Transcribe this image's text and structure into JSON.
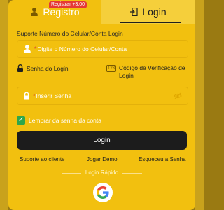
{
  "tabs": {
    "register": {
      "label": "Registro",
      "badge": "Registrar +3,00"
    },
    "login": {
      "label": "Login"
    }
  },
  "form": {
    "phone_label": "Suporte Número do Celular/Conta Login",
    "phone_placeholder": "Digite o Número do Celular/Conta",
    "mode_password": "Senha do Login",
    "mode_code": "Código de Verificação de Login",
    "password_placeholder": "Inserir Senha",
    "remember_label": "Lembrar da senha da conta",
    "submit_label": "Login"
  },
  "links": {
    "support": "Suporte ao cliente",
    "demo": "Jogar Demo",
    "forgot": "Esqueceu a Senha"
  },
  "quick_login": {
    "label": "Login Rápido"
  },
  "colors": {
    "panel": "#f2c00f",
    "button": "#1c1c1c",
    "checkbox": "#2fa64b",
    "badge": "#e53935"
  },
  "icons": {
    "register": "user-icon",
    "login": "login-door-icon",
    "phone_field": "user-icon",
    "password_mode": "lock-icon",
    "code_mode": "code-123-icon",
    "password_field": "lock-icon",
    "visibility": "eye-off-icon",
    "remember": "checkmark-icon",
    "quick_login": "google-icon"
  }
}
